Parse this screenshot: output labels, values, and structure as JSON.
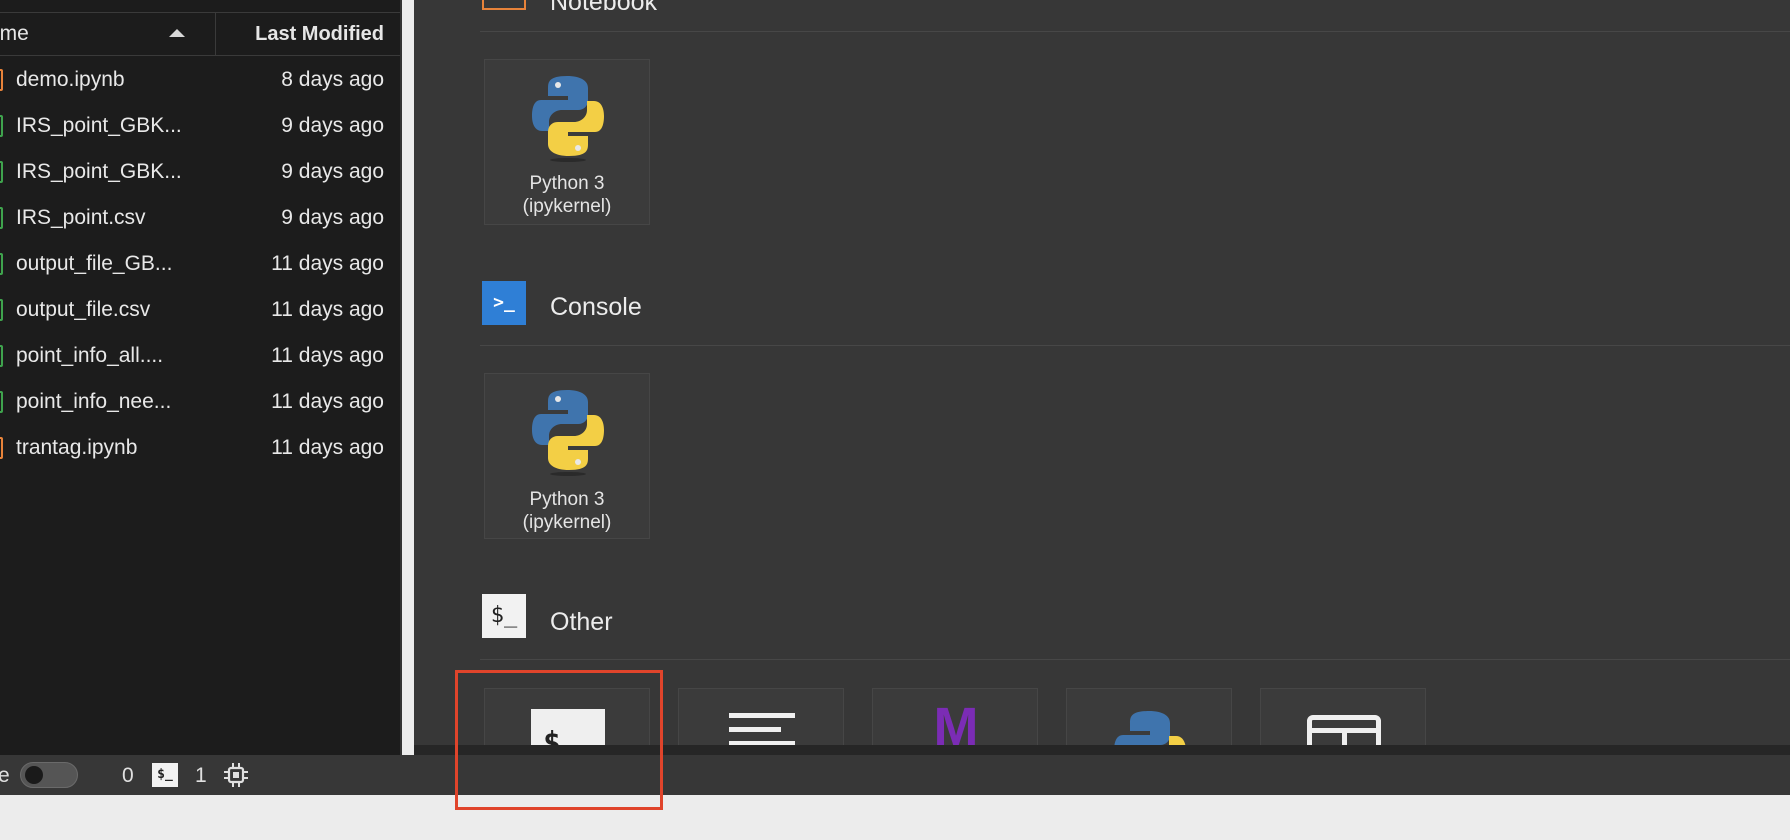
{
  "file_browser": {
    "header": {
      "name_label": "ame",
      "modified_label": "Last Modified"
    },
    "files": [
      {
        "name": "demo.ipynb",
        "modified": "8 days ago",
        "type": "notebook"
      },
      {
        "name": "IRS_point_GBK...",
        "modified": "9 days ago",
        "type": "csv"
      },
      {
        "name": "IRS_point_GBK...",
        "modified": "9 days ago",
        "type": "csv"
      },
      {
        "name": "IRS_point.csv",
        "modified": "9 days ago",
        "type": "csv"
      },
      {
        "name": "output_file_GB...",
        "modified": "11 days ago",
        "type": "csv"
      },
      {
        "name": "output_file.csv",
        "modified": "11 days ago",
        "type": "csv"
      },
      {
        "name": "point_info_all....",
        "modified": "11 days ago",
        "type": "csv"
      },
      {
        "name": "point_info_nee...",
        "modified": "11 days ago",
        "type": "csv"
      },
      {
        "name": "trantag.ipynb",
        "modified": "11 days ago",
        "type": "notebook"
      }
    ]
  },
  "launcher": {
    "notebook_section": {
      "title": "Notebook"
    },
    "notebook_kernel": {
      "label": "Python 3\n(ipykernel)"
    },
    "console_section": {
      "title": "Console",
      "icon_glyph": ">_"
    },
    "console_kernel": {
      "label": "Python 3\n(ipykernel)"
    },
    "other_section": {
      "title": "Other",
      "icon_glyph": "$_"
    },
    "other_items": [
      {
        "name": "terminal",
        "icon": "terminal-icon",
        "glyph": "$"
      },
      {
        "name": "text-file",
        "icon": "text-file-icon"
      },
      {
        "name": "markdown-file",
        "icon": "markdown-icon",
        "glyph": "M"
      },
      {
        "name": "python-file",
        "icon": "python-icon"
      },
      {
        "name": "contextual-help",
        "icon": "help-icon"
      }
    ]
  },
  "status_bar": {
    "simple_label": "e",
    "kernel_count": "0",
    "terminal_glyph": "$_",
    "terminal_count": "1"
  },
  "colors": {
    "notebook_icon": "#e8833a",
    "csv_icon": "#3fa34d",
    "console_icon": "#2f7fd6",
    "markdown": "#7b2cb5",
    "highlight": "#e0442b"
  }
}
